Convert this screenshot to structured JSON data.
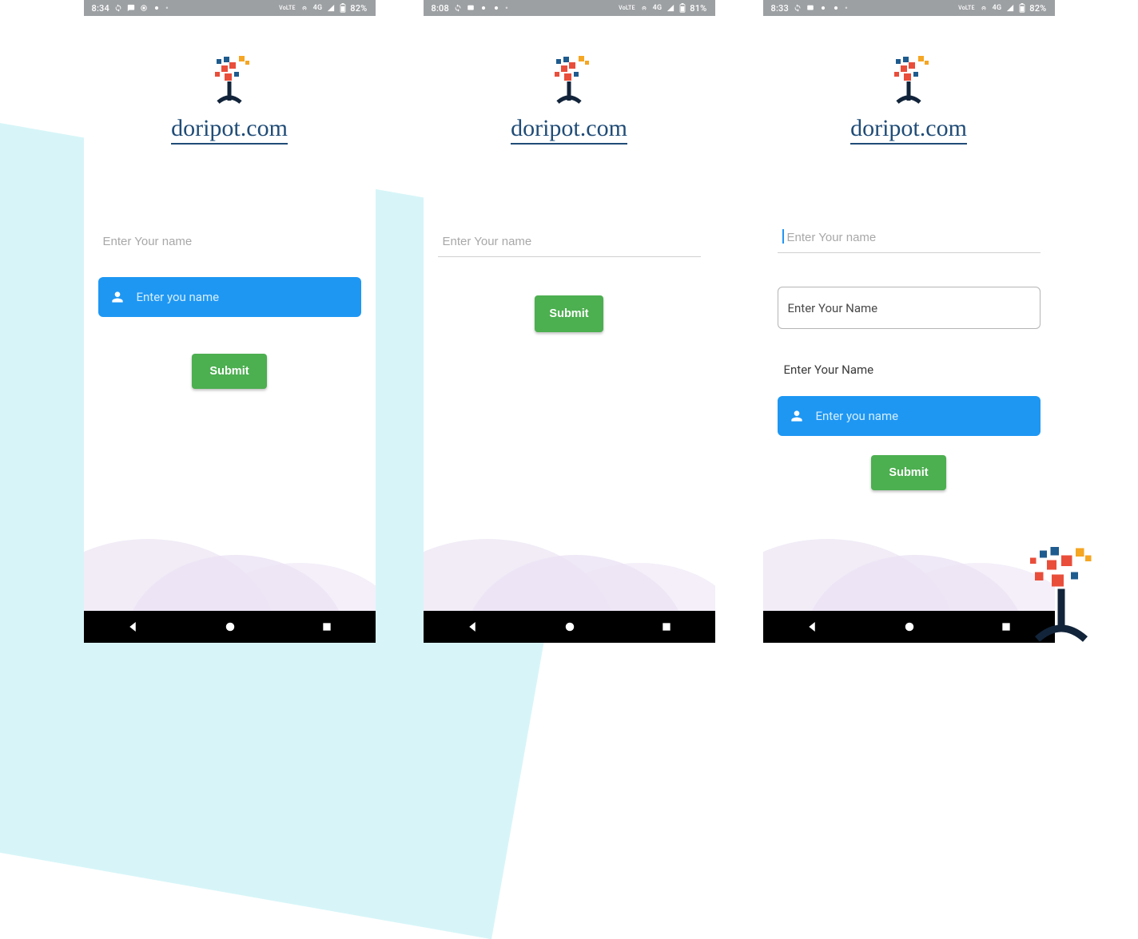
{
  "brand": "doripot.com",
  "screens": [
    {
      "status": {
        "time": "8:34",
        "net": "4G",
        "batt": "82%",
        "lte": "VoLTE"
      },
      "input1_placeholder": "Enter Your name",
      "filled_placeholder": "Enter you name",
      "submit": "Submit"
    },
    {
      "status": {
        "time": "8:08",
        "net": "4G",
        "batt": "81%",
        "lte": "VoLTE"
      },
      "input1_placeholder": "Enter Your name",
      "submit": "Submit"
    },
    {
      "status": {
        "time": "8:33",
        "net": "4G",
        "batt": "82%",
        "lte": "VoLTE"
      },
      "input1_placeholder": "Enter Your name",
      "outline_placeholder": "Enter Your Name",
      "label_text": "Enter Your Name",
      "filled_placeholder": "Enter you name",
      "submit": "Submit"
    }
  ]
}
